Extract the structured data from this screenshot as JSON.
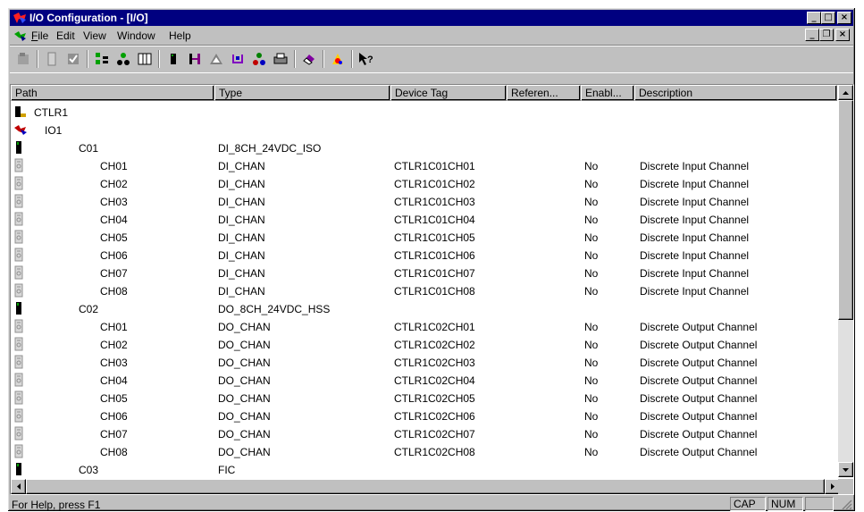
{
  "window": {
    "title": "I/O Configuration - [I/O]",
    "accent": "#000080"
  },
  "menu": [
    "File",
    "Edit",
    "View",
    "Window",
    "Help"
  ],
  "columns": [
    "Path",
    "Type",
    "Device Tag",
    "Referen...",
    "Enabl...",
    "Description"
  ],
  "rows": [
    {
      "path": "CTLR1",
      "indent": 1,
      "icon": "controller-icon",
      "type": "",
      "tag": "",
      "ref": "",
      "enabled": "",
      "desc": ""
    },
    {
      "path": "IO1",
      "indent": 2,
      "icon": "io-network-icon",
      "type": "",
      "tag": "",
      "ref": "",
      "enabled": "",
      "desc": ""
    },
    {
      "path": "C01",
      "indent": 3,
      "icon": "card-icon",
      "type": "DI_8CH_24VDC_ISO",
      "tag": "",
      "ref": "",
      "enabled": "",
      "desc": ""
    },
    {
      "path": "CH01",
      "indent": 4,
      "icon": "channel-icon",
      "type": "DI_CHAN",
      "tag": "CTLR1C01CH01",
      "ref": "",
      "enabled": "No",
      "desc": "Discrete Input Channel"
    },
    {
      "path": "CH02",
      "indent": 4,
      "icon": "channel-icon",
      "type": "DI_CHAN",
      "tag": "CTLR1C01CH02",
      "ref": "",
      "enabled": "No",
      "desc": "Discrete Input Channel"
    },
    {
      "path": "CH03",
      "indent": 4,
      "icon": "channel-icon",
      "type": "DI_CHAN",
      "tag": "CTLR1C01CH03",
      "ref": "",
      "enabled": "No",
      "desc": "Discrete Input Channel"
    },
    {
      "path": "CH04",
      "indent": 4,
      "icon": "channel-icon",
      "type": "DI_CHAN",
      "tag": "CTLR1C01CH04",
      "ref": "",
      "enabled": "No",
      "desc": "Discrete Input Channel"
    },
    {
      "path": "CH05",
      "indent": 4,
      "icon": "channel-icon",
      "type": "DI_CHAN",
      "tag": "CTLR1C01CH05",
      "ref": "",
      "enabled": "No",
      "desc": "Discrete Input Channel"
    },
    {
      "path": "CH06",
      "indent": 4,
      "icon": "channel-icon",
      "type": "DI_CHAN",
      "tag": "CTLR1C01CH06",
      "ref": "",
      "enabled": "No",
      "desc": "Discrete Input Channel"
    },
    {
      "path": "CH07",
      "indent": 4,
      "icon": "channel-icon",
      "type": "DI_CHAN",
      "tag": "CTLR1C01CH07",
      "ref": "",
      "enabled": "No",
      "desc": "Discrete Input Channel"
    },
    {
      "path": "CH08",
      "indent": 4,
      "icon": "channel-icon",
      "type": "DI_CHAN",
      "tag": "CTLR1C01CH08",
      "ref": "",
      "enabled": "No",
      "desc": "Discrete Input Channel"
    },
    {
      "path": "C02",
      "indent": 3,
      "icon": "card-icon",
      "type": "DO_8CH_24VDC_HSS",
      "tag": "",
      "ref": "",
      "enabled": "",
      "desc": ""
    },
    {
      "path": "CH01",
      "indent": 4,
      "icon": "channel-icon",
      "type": "DO_CHAN",
      "tag": "CTLR1C02CH01",
      "ref": "",
      "enabled": "No",
      "desc": "Discrete Output Channel"
    },
    {
      "path": "CH02",
      "indent": 4,
      "icon": "channel-icon",
      "type": "DO_CHAN",
      "tag": "CTLR1C02CH02",
      "ref": "",
      "enabled": "No",
      "desc": "Discrete Output Channel"
    },
    {
      "path": "CH03",
      "indent": 4,
      "icon": "channel-icon",
      "type": "DO_CHAN",
      "tag": "CTLR1C02CH03",
      "ref": "",
      "enabled": "No",
      "desc": "Discrete Output Channel"
    },
    {
      "path": "CH04",
      "indent": 4,
      "icon": "channel-icon",
      "type": "DO_CHAN",
      "tag": "CTLR1C02CH04",
      "ref": "",
      "enabled": "No",
      "desc": "Discrete Output Channel"
    },
    {
      "path": "CH05",
      "indent": 4,
      "icon": "channel-icon",
      "type": "DO_CHAN",
      "tag": "CTLR1C02CH05",
      "ref": "",
      "enabled": "No",
      "desc": "Discrete Output Channel"
    },
    {
      "path": "CH06",
      "indent": 4,
      "icon": "channel-icon",
      "type": "DO_CHAN",
      "tag": "CTLR1C02CH06",
      "ref": "",
      "enabled": "No",
      "desc": "Discrete Output Channel"
    },
    {
      "path": "CH07",
      "indent": 4,
      "icon": "channel-icon",
      "type": "DO_CHAN",
      "tag": "CTLR1C02CH07",
      "ref": "",
      "enabled": "No",
      "desc": "Discrete Output Channel"
    },
    {
      "path": "CH08",
      "indent": 4,
      "icon": "channel-icon",
      "type": "DO_CHAN",
      "tag": "CTLR1C02CH08",
      "ref": "",
      "enabled": "No",
      "desc": "Discrete Output Channel"
    },
    {
      "path": "C03",
      "indent": 3,
      "icon": "card-icon",
      "type": "FIC",
      "tag": "",
      "ref": "",
      "enabled": "",
      "desc": ""
    }
  ],
  "status": {
    "message": "For Help, press F1",
    "cap": "CAP",
    "num": "NUM"
  }
}
